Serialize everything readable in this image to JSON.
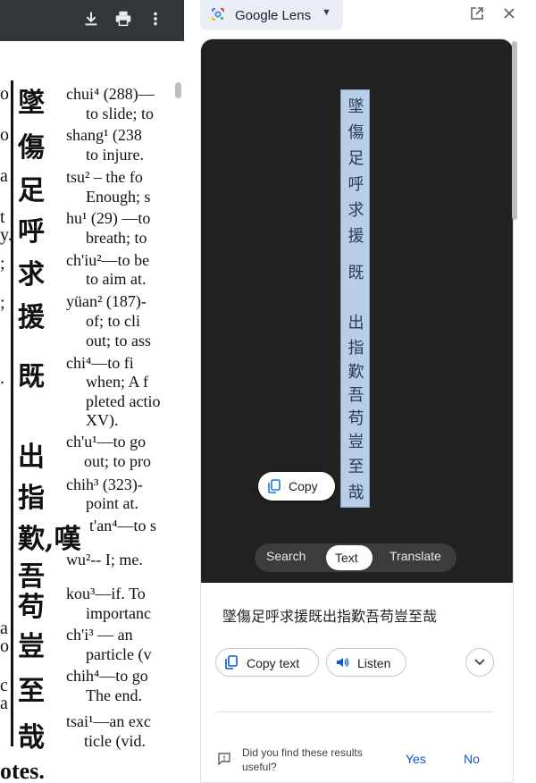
{
  "pdf": {
    "toolbar_icons": [
      "download-icon",
      "print-icon",
      "more-vert-icon"
    ],
    "left_edge": [
      "o",
      "o",
      "a",
      "t",
      "y.",
      ";",
      ";",
      ".",
      "a",
      "o",
      "c",
      "a"
    ],
    "entries": [
      {
        "char": "墜",
        "line1": "chui⁴  (288)—",
        "line2": "to slide; to"
      },
      {
        "char": "傷",
        "line1": "shang¹  (238",
        "line2": "to injure."
      },
      {
        "char": "足",
        "line1": "tsu² – the  fo",
        "line2": "Enough; s"
      },
      {
        "char": "呼",
        "line1": "hu¹  (29) —to",
        "line2": "breath; to"
      },
      {
        "char": "求",
        "line1": "ch'iu²—to be",
        "line2": "to aim at."
      },
      {
        "char": "援",
        "line1": "yüan²  (187)-",
        "line2": "of;  to  cli"
      },
      {
        "char": "既",
        "line1": "chi⁴—to    fi",
        "line2": "when;  A  f"
      },
      {
        "char": "出",
        "line1": "ch'u¹—to go",
        "line2": "out; to pro"
      },
      {
        "char": "指",
        "line1": "chih³  (323)-",
        "line2": "point at."
      },
      {
        "char": "歎,嘆",
        "line1": "t'an⁴—to s",
        "line2": ""
      },
      {
        "char": "吾",
        "line1": "wu²-- I; me.",
        "line2": ""
      },
      {
        "char": "苟",
        "line1": "kou³—if.   To",
        "line2": "importanc"
      },
      {
        "char": "豈",
        "line1": "ch'i³ — an",
        "line2": "particle (v"
      },
      {
        "char": "至",
        "line1": "chih⁴—to go",
        "line2": "The end."
      },
      {
        "char": "哉",
        "line1": "tsai¹—an exc",
        "line2": "ticle (vid."
      }
    ],
    "extra_lines": [
      "out; to ass",
      "pleted actio",
      "XV)."
    ],
    "bottom_note": "otes."
  },
  "lens": {
    "title": "Google Lens",
    "strip_chars": [
      "墜",
      "傷",
      "足",
      "呼",
      "求",
      "援",
      "既",
      "出",
      "指",
      "歎",
      "吾",
      "苟",
      "豈",
      "至",
      "哉"
    ],
    "copy_label": "Copy",
    "tabs": {
      "search": "Search",
      "text": "Text",
      "translate": "Translate",
      "active": "Text"
    },
    "result_text": "墜傷足呼求援既出指歎吾苟豈至哉",
    "copy_text_label": "Copy text",
    "listen_label": "Listen",
    "feedback_question": "Did you find these results useful?",
    "yes_label": "Yes",
    "no_label": "No"
  }
}
